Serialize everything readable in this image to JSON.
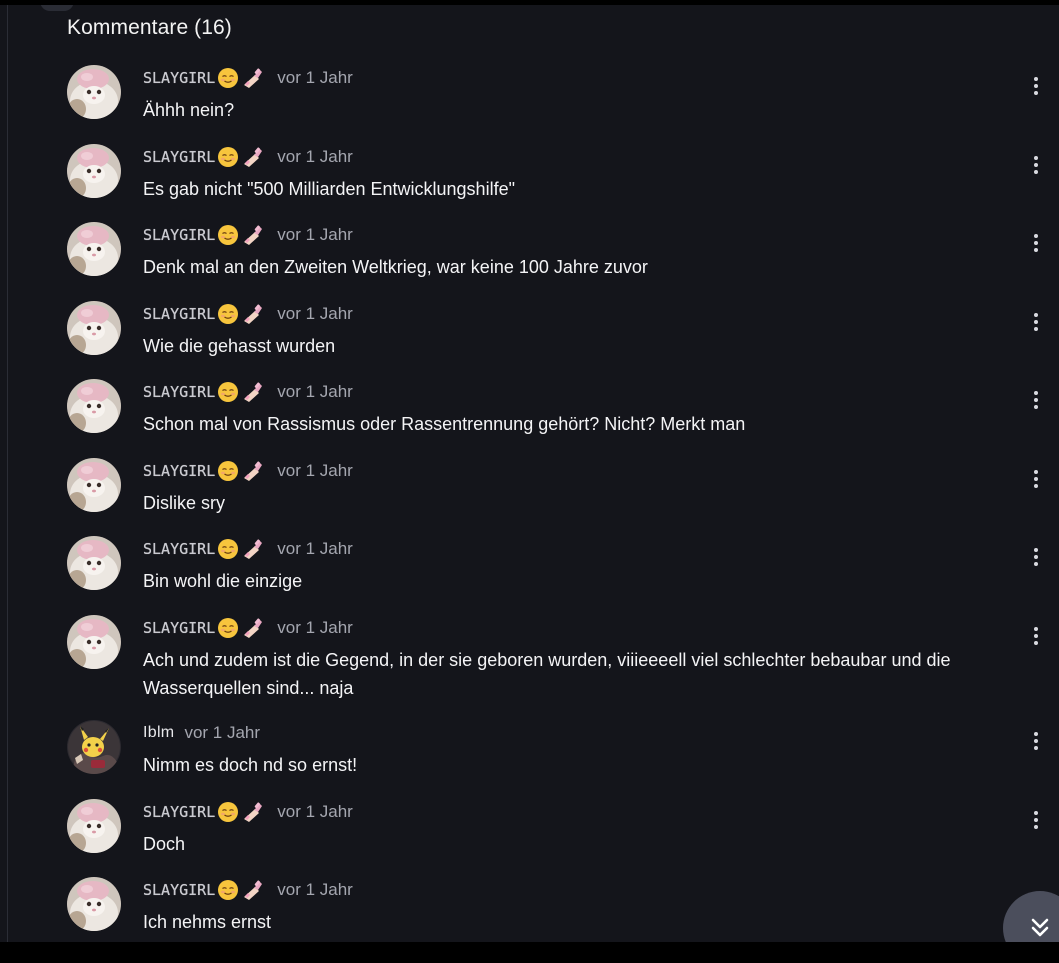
{
  "section": {
    "title": "Kommentare (16)"
  },
  "comments": [
    {
      "author": "SLAYGIRL",
      "time": "vor 1 Jahr",
      "text": "Ähhh nein?"
    },
    {
      "author": "SLAYGIRL",
      "time": "vor 1 Jahr",
      "text": "Es gab nicht \"500 Milliarden Entwicklungshilfe\""
    },
    {
      "author": "SLAYGIRL",
      "time": "vor 1 Jahr",
      "text": "Denk mal an den Zweiten Weltkrieg, war keine 100 Jahre zuvor"
    },
    {
      "author": "SLAYGIRL",
      "time": "vor 1 Jahr",
      "text": "Wie die gehasst wurden"
    },
    {
      "author": "SLAYGIRL",
      "time": "vor 1 Jahr",
      "text": "Schon mal von Rassismus oder Rassentrennung gehört? Nicht? Merkt man"
    },
    {
      "author": "SLAYGIRL",
      "time": "vor 1 Jahr",
      "text": "Dislike sry"
    },
    {
      "author": "SLAYGIRL",
      "time": "vor 1 Jahr",
      "text": "Bin wohl die einzige"
    },
    {
      "author": "SLAYGIRL",
      "time": "vor 1 Jahr",
      "text": "Ach und zudem ist die Gegend, in der sie geboren wurden, viiieeeell viel schlechter bebaubar und die Wasserquellen sind... naja"
    },
    {
      "author": "Iblm",
      "time": "vor 1 Jahr",
      "text": "Nimm es doch nd so ernst!"
    },
    {
      "author": "SLAYGIRL",
      "time": "vor 1 Jahr",
      "text": "Doch"
    },
    {
      "author": "SLAYGIRL",
      "time": "vor 1 Jahr",
      "text": "Ich nehms ernst"
    }
  ],
  "icons": {
    "relieved_emoji": "relieved-face-emoji",
    "nail_polish_emoji": "nail-polish-emoji",
    "more_menu": "vertical-ellipsis-icon",
    "scroll_down": "double-chevron-down-icon"
  },
  "colors": {
    "background": "#14151b",
    "text": "#f4f4f6",
    "muted": "#a4a6af",
    "fab": "#4b4e5c"
  }
}
